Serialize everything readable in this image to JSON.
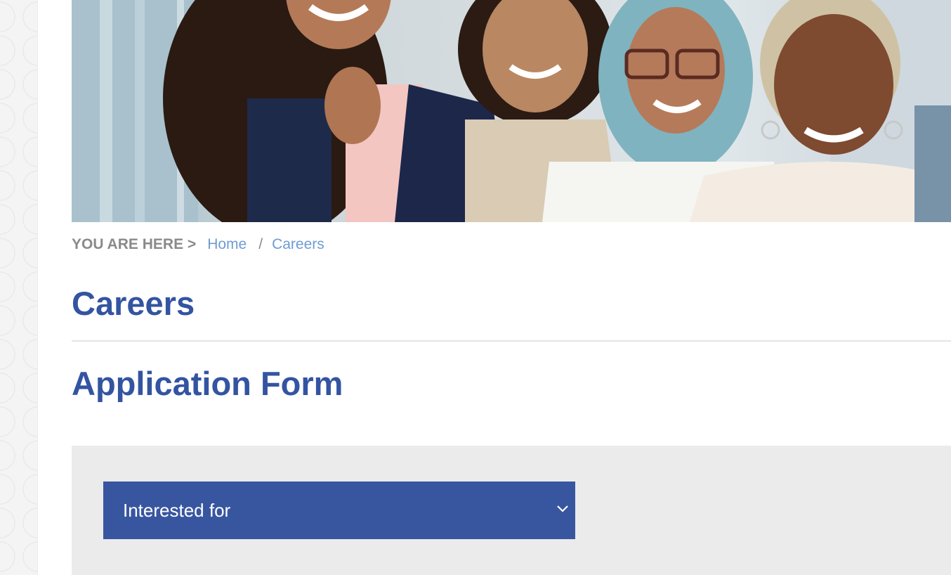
{
  "hero": {
    "image": "careers-hero-photo-smiling-women"
  },
  "breadcrumb": {
    "prefix": "YOU ARE HERE >",
    "items": [
      {
        "label": "Home"
      },
      {
        "label": "Careers"
      }
    ],
    "separator": "/"
  },
  "page": {
    "title": "Careers"
  },
  "form": {
    "title": "Application Form",
    "interest_select": {
      "value": "Interested for",
      "icon": "chevron-down-icon"
    }
  },
  "colors": {
    "brand_blue": "#3354a1",
    "link_blue": "#6f9bd4",
    "select_bg": "#3856a0",
    "panel_bg": "#ebebeb"
  }
}
